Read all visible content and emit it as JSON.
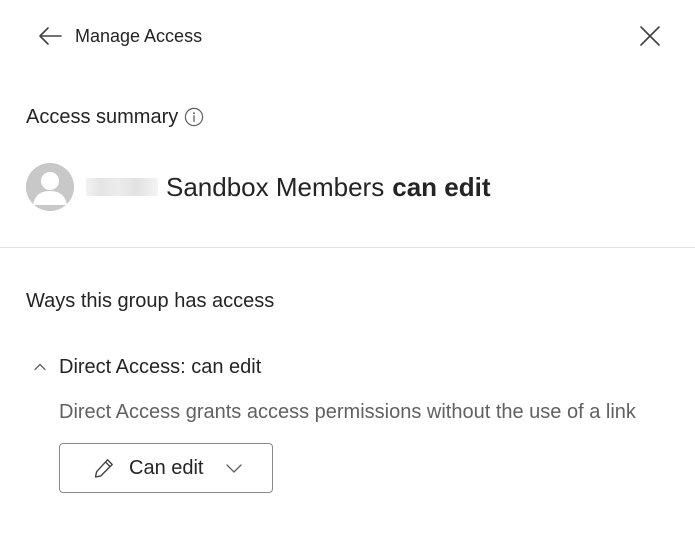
{
  "header": {
    "title": "Manage Access",
    "back_icon": "arrow-left-icon",
    "close_icon": "close-icon"
  },
  "summary": {
    "heading": "Access summary",
    "info_icon": "info-icon",
    "group_name": "Sandbox Members",
    "permission": "can edit"
  },
  "ways": {
    "heading": "Ways this group has access"
  },
  "direct_access": {
    "title": "Direct Access: can edit",
    "expanded": true,
    "description": "Direct Access grants access permissions without the use of a link",
    "dropdown": {
      "selected": "Can edit",
      "icon": "pencil-icon"
    }
  },
  "colors": {
    "text": "#242424",
    "secondary_text": "#616161",
    "divider": "#e1e1e1",
    "avatar_bg": "#c8c8c8"
  }
}
